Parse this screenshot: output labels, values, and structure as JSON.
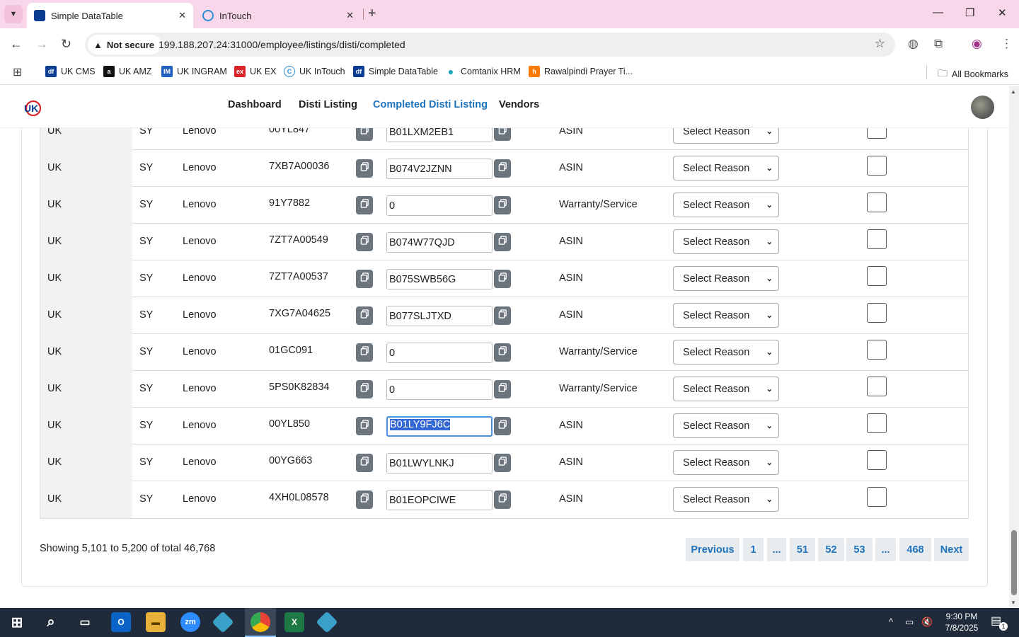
{
  "browser": {
    "tabs": [
      {
        "title": "Simple DataTable",
        "active": true,
        "favicon": "df-icon"
      },
      {
        "title": "InTouch",
        "active": false,
        "favicon": "intouch-icon"
      }
    ],
    "security_label": "Not secure",
    "url": "199.188.207.24:31000/employee/listings/disti/completed",
    "bookmarks": [
      {
        "label": "UK CMS",
        "icon": "df",
        "color": "#0a3d91"
      },
      {
        "label": "UK AMZ",
        "icon": "a",
        "color": "#111111"
      },
      {
        "label": "UK INGRAM",
        "icon": "IM",
        "color": "#1f5fbf"
      },
      {
        "label": "UK EX",
        "icon": "ex",
        "color": "#d9252a"
      },
      {
        "label": "UK InTouch",
        "icon": "C",
        "color": "#2a8fd6"
      },
      {
        "label": "Simple DataTable",
        "icon": "df",
        "color": "#0a3d91"
      },
      {
        "label": "Comtanix HRM",
        "icon": "●",
        "color": "#1aa3b8"
      },
      {
        "label": "Rawalpindi Prayer Ti...",
        "icon": "h",
        "color": "#ff7a00"
      }
    ],
    "all_bookmarks": "All Bookmarks"
  },
  "nav": {
    "links": [
      "Dashboard",
      "Disti Listing",
      "Completed Disti Listing",
      "Vendors"
    ],
    "active_index": 2
  },
  "table": {
    "rows": [
      {
        "region": "UK",
        "type": "SY",
        "brand": "Lenovo",
        "part": "00YL847",
        "asin": "B01LXM2EB1",
        "kind": "ASIN",
        "reason": "Select Reason"
      },
      {
        "region": "UK",
        "type": "SY",
        "brand": "Lenovo",
        "part": "7XB7A00036",
        "asin": "B074V2JZNN",
        "kind": "ASIN",
        "reason": "Select Reason"
      },
      {
        "region": "UK",
        "type": "SY",
        "brand": "Lenovo",
        "part": "91Y7882",
        "asin": "0",
        "kind": "Warranty/Service",
        "reason": "Select Reason"
      },
      {
        "region": "UK",
        "type": "SY",
        "brand": "Lenovo",
        "part": "7ZT7A00549",
        "asin": "B074W77QJD",
        "kind": "ASIN",
        "reason": "Select Reason"
      },
      {
        "region": "UK",
        "type": "SY",
        "brand": "Lenovo",
        "part": "7ZT7A00537",
        "asin": "B075SWB56G",
        "kind": "ASIN",
        "reason": "Select Reason"
      },
      {
        "region": "UK",
        "type": "SY",
        "brand": "Lenovo",
        "part": "7XG7A04625",
        "asin": "B077SLJTXD",
        "kind": "ASIN",
        "reason": "Select Reason"
      },
      {
        "region": "UK",
        "type": "SY",
        "brand": "Lenovo",
        "part": "01GC091",
        "asin": "0",
        "kind": "Warranty/Service",
        "reason": "Select Reason"
      },
      {
        "region": "UK",
        "type": "SY",
        "brand": "Lenovo",
        "part": "5PS0K82834",
        "asin": "0",
        "kind": "Warranty/Service",
        "reason": "Select Reason"
      },
      {
        "region": "UK",
        "type": "SY",
        "brand": "Lenovo",
        "part": "00YL850",
        "asin": "B01LY9FJ6C",
        "kind": "ASIN",
        "reason": "Select Reason",
        "focused": true
      },
      {
        "region": "UK",
        "type": "SY",
        "brand": "Lenovo",
        "part": "00YG663",
        "asin": "B01LWYLNKJ",
        "kind": "ASIN",
        "reason": "Select Reason"
      },
      {
        "region": "UK",
        "type": "SY",
        "brand": "Lenovo",
        "part": "4XH0L08578",
        "asin": "B01EOPCIWE",
        "kind": "ASIN",
        "reason": "Select Reason"
      }
    ]
  },
  "footer": {
    "showing": "Showing 5,101 to 5,200 of total 46,768",
    "pagination": [
      "Previous",
      "1",
      "...",
      "51",
      "52",
      "53",
      "...",
      "468",
      "Next"
    ]
  },
  "taskbar": {
    "time": "9:30 PM",
    "date": "7/8/2025",
    "notification_count": "1"
  }
}
